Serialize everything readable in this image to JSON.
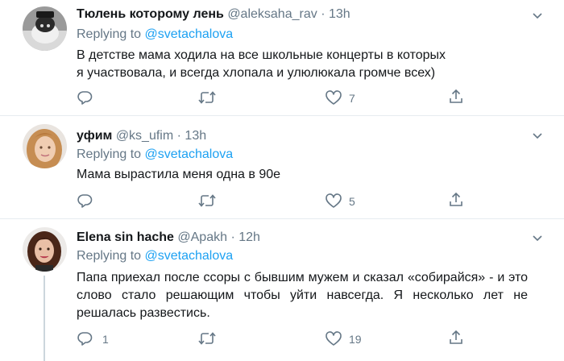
{
  "tweets": [
    {
      "name": "Тюлень которому лень",
      "handle": "@aleksaha_rav",
      "dot": "·",
      "time": "13h",
      "replying_prefix": "Replying to ",
      "replying_to": "@svetachalova",
      "body": "В детстве мама ходила на все школьные концерты в которых я участвовала, и всегда хлопала и улюлюкала громче всех)",
      "reply_count": "",
      "retweet_count": "",
      "like_count": "7"
    },
    {
      "name": "уфим",
      "handle": "@ks_ufim",
      "dot": "·",
      "time": "13h",
      "replying_prefix": "Replying to ",
      "replying_to": "@svetachalova",
      "body": "Мама вырастила меня одна в 90е",
      "reply_count": "",
      "retweet_count": "",
      "like_count": "5"
    },
    {
      "name": "Elena sin hache",
      "handle": "@Apakh",
      "dot": "·",
      "time": "12h",
      "replying_prefix": "Replying to ",
      "replying_to": "@svetachalova",
      "body": "Папа приехал после ссоры с бывшим мужем и сказал «собирайся» - и это слово стало решающим чтобы уйти навсегда. Я несколько лет не решалась развестись.",
      "reply_count": "1",
      "retweet_count": "",
      "like_count": "19"
    }
  ],
  "colors": {
    "accent": "#1da1f2",
    "secondary_text": "#657786",
    "primary_text": "#14171a",
    "divider": "#e6ecf0"
  },
  "icons": [
    "reply-icon",
    "retweet-icon",
    "like-icon",
    "share-icon",
    "chevron-down-icon"
  ]
}
